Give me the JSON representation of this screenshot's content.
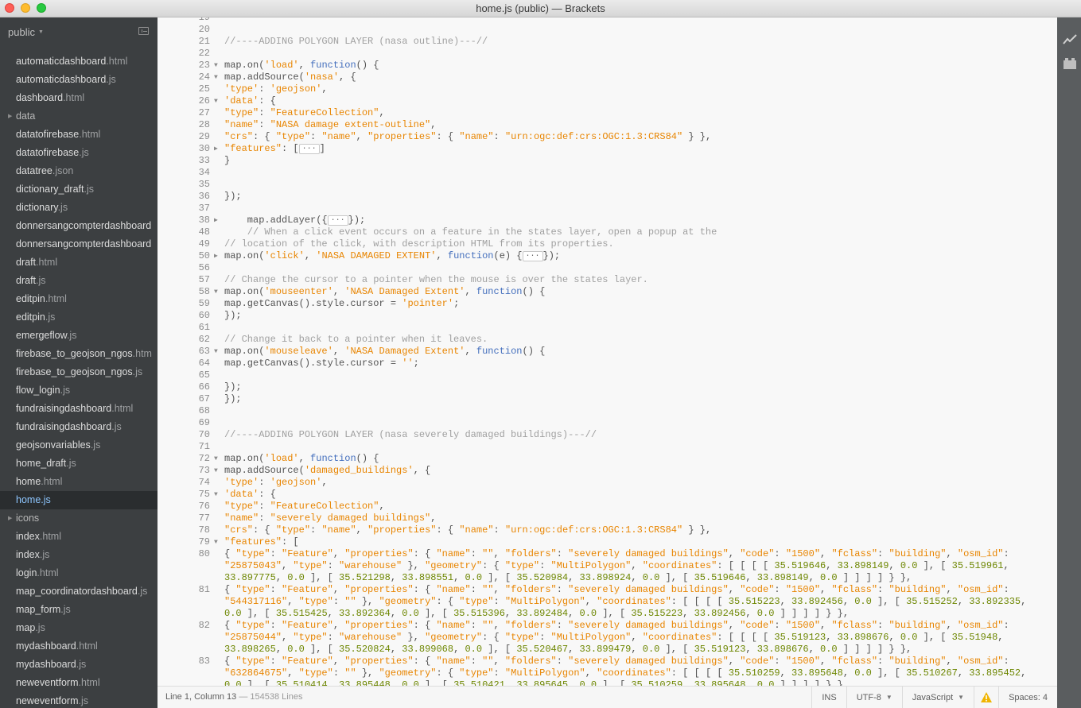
{
  "window": {
    "title": "home.js (public) — Brackets"
  },
  "sidebar": {
    "project_label": "public",
    "files": [
      {
        "name": "automaticdashboard",
        "ext": ".html",
        "type": "file"
      },
      {
        "name": "automaticdashboard",
        "ext": ".js",
        "type": "file"
      },
      {
        "name": "dashboard",
        "ext": ".html",
        "type": "file"
      },
      {
        "name": "data",
        "ext": "",
        "type": "folder"
      },
      {
        "name": "datatofirebase",
        "ext": ".html",
        "type": "file"
      },
      {
        "name": "datatofirebase",
        "ext": ".js",
        "type": "file"
      },
      {
        "name": "datatree",
        "ext": ".json",
        "type": "file"
      },
      {
        "name": "dictionary_draft",
        "ext": ".js",
        "type": "file"
      },
      {
        "name": "dictionary",
        "ext": ".js",
        "type": "file"
      },
      {
        "name": "donnersangcompterdashboard",
        "ext": "",
        "type": "file"
      },
      {
        "name": "donnersangcompterdashboard",
        "ext": "",
        "type": "file"
      },
      {
        "name": "draft",
        "ext": ".html",
        "type": "file"
      },
      {
        "name": "draft",
        "ext": ".js",
        "type": "file"
      },
      {
        "name": "editpin",
        "ext": ".html",
        "type": "file"
      },
      {
        "name": "editpin",
        "ext": ".js",
        "type": "file"
      },
      {
        "name": "emergeflow",
        "ext": ".js",
        "type": "file"
      },
      {
        "name": "firebase_to_geojson_ngos",
        "ext": ".htm",
        "type": "file"
      },
      {
        "name": "firebase_to_geojson_ngos",
        "ext": ".js",
        "type": "file"
      },
      {
        "name": "flow_login",
        "ext": ".js",
        "type": "file"
      },
      {
        "name": "fundraisingdashboard",
        "ext": ".html",
        "type": "file"
      },
      {
        "name": "fundraisingdashboard",
        "ext": ".js",
        "type": "file"
      },
      {
        "name": "geojsonvariables",
        "ext": ".js",
        "type": "file"
      },
      {
        "name": "home_draft",
        "ext": ".js",
        "type": "file"
      },
      {
        "name": "home",
        "ext": ".html",
        "type": "file"
      },
      {
        "name": "home",
        "ext": ".js",
        "type": "file",
        "selected": true
      },
      {
        "name": "icons",
        "ext": "",
        "type": "folder"
      },
      {
        "name": "index",
        "ext": ".html",
        "type": "file"
      },
      {
        "name": "index",
        "ext": ".js",
        "type": "file"
      },
      {
        "name": "login",
        "ext": ".html",
        "type": "file"
      },
      {
        "name": "map_coordinatordashboard",
        "ext": ".js",
        "type": "file"
      },
      {
        "name": "map_form",
        "ext": ".js",
        "type": "file"
      },
      {
        "name": "map",
        "ext": ".js",
        "type": "file"
      },
      {
        "name": "mydashboard",
        "ext": ".html",
        "type": "file"
      },
      {
        "name": "mydashboard",
        "ext": ".js",
        "type": "file"
      },
      {
        "name": "neweventform",
        "ext": ".html",
        "type": "file"
      },
      {
        "name": "neweventform",
        "ext": ".js",
        "type": "file"
      }
    ]
  },
  "editor": {
    "lines": [
      {
        "n": "19",
        "fold": "",
        "t": ""
      },
      {
        "n": "20",
        "fold": "",
        "t": ""
      },
      {
        "n": "21",
        "fold": "",
        "t": "//----ADDING POLYGON LAYER (nasa outline)---//"
      },
      {
        "n": "22",
        "fold": "",
        "t": ""
      },
      {
        "n": "23",
        "fold": "▼",
        "t": "map.on('load', function() {"
      },
      {
        "n": "24",
        "fold": "▼",
        "t": "map.addSource('nasa', {"
      },
      {
        "n": "25",
        "fold": "",
        "t": "'type': 'geojson',"
      },
      {
        "n": "26",
        "fold": "▼",
        "t": "'data': {"
      },
      {
        "n": "27",
        "fold": "",
        "t": "\"type\": \"FeatureCollection\","
      },
      {
        "n": "28",
        "fold": "",
        "t": "\"name\": \"NASA damage extent-outline\","
      },
      {
        "n": "29",
        "fold": "",
        "t": "\"crs\": { \"type\": \"name\", \"properties\": { \"name\": \"urn:ogc:def:crs:OGC:1.3:CRS84\" } },"
      },
      {
        "n": "30",
        "fold": "▶",
        "t": "\"features\": [···]"
      },
      {
        "n": "33",
        "fold": "",
        "t": "}"
      },
      {
        "n": "34",
        "fold": "",
        "t": ""
      },
      {
        "n": "35",
        "fold": "",
        "t": ""
      },
      {
        "n": "36",
        "fold": "",
        "t": "});"
      },
      {
        "n": "37",
        "fold": "",
        "t": ""
      },
      {
        "n": "38",
        "fold": "▶",
        "t": "    map.addLayer({···});"
      },
      {
        "n": "48",
        "fold": "",
        "t": "    // When a click event occurs on a feature in the states layer, open a popup at the"
      },
      {
        "n": "49",
        "fold": "",
        "t": "// location of the click, with description HTML from its properties."
      },
      {
        "n": "50",
        "fold": "▶",
        "t": "map.on('click', 'NASA DAMAGED EXTENT', function(e) {···});"
      },
      {
        "n": "56",
        "fold": "",
        "t": ""
      },
      {
        "n": "57",
        "fold": "",
        "t": "// Change the cursor to a pointer when the mouse is over the states layer."
      },
      {
        "n": "58",
        "fold": "▼",
        "t": "map.on('mouseenter', 'NASA Damaged Extent', function() {"
      },
      {
        "n": "59",
        "fold": "",
        "t": "map.getCanvas().style.cursor = 'pointer';"
      },
      {
        "n": "60",
        "fold": "",
        "t": "});"
      },
      {
        "n": "61",
        "fold": "",
        "t": ""
      },
      {
        "n": "62",
        "fold": "",
        "t": "// Change it back to a pointer when it leaves."
      },
      {
        "n": "63",
        "fold": "▼",
        "t": "map.on('mouseleave', 'NASA Damaged Extent', function() {"
      },
      {
        "n": "64",
        "fold": "",
        "t": "map.getCanvas().style.cursor = '';"
      },
      {
        "n": "65",
        "fold": "",
        "t": ""
      },
      {
        "n": "66",
        "fold": "",
        "t": "});"
      },
      {
        "n": "67",
        "fold": "",
        "t": "});"
      },
      {
        "n": "68",
        "fold": "",
        "t": ""
      },
      {
        "n": "69",
        "fold": "",
        "t": ""
      },
      {
        "n": "70",
        "fold": "",
        "t": "//----ADDING POLYGON LAYER (nasa severely damaged buildings)---//"
      },
      {
        "n": "71",
        "fold": "",
        "t": ""
      },
      {
        "n": "72",
        "fold": "▼",
        "t": "map.on('load', function() {"
      },
      {
        "n": "73",
        "fold": "▼",
        "t": "map.addSource('damaged_buildings', {"
      },
      {
        "n": "74",
        "fold": "",
        "t": "'type': 'geojson',"
      },
      {
        "n": "75",
        "fold": "▼",
        "t": "'data': {"
      },
      {
        "n": "76",
        "fold": "",
        "t": "\"type\": \"FeatureCollection\","
      },
      {
        "n": "77",
        "fold": "",
        "t": "\"name\": \"severely damaged buildings\","
      },
      {
        "n": "78",
        "fold": "",
        "t": "\"crs\": { \"type\": \"name\", \"properties\": { \"name\": \"urn:ogc:def:crs:OGC:1.3:CRS84\" } },"
      },
      {
        "n": "79",
        "fold": "▼",
        "t": "\"features\": ["
      },
      {
        "n": "80",
        "fold": "",
        "t": "{ \"type\": \"Feature\", \"properties\": { \"name\": \"\", \"folders\": \"severely damaged buildings\", \"code\": \"1500\", \"fclass\": \"building\", \"osm_id\":"
      },
      {
        "n": "",
        "fold": "",
        "t": "\"25875043\", \"type\": \"warehouse\" }, \"geometry\": { \"type\": \"MultiPolygon\", \"coordinates\": [ [ [ [ 35.519646, 33.898149, 0.0 ], [ 35.519961,"
      },
      {
        "n": "",
        "fold": "",
        "t": "33.897775, 0.0 ], [ 35.521298, 33.898551, 0.0 ], [ 35.520984, 33.898924, 0.0 ], [ 35.519646, 33.898149, 0.0 ] ] ] ] } },"
      },
      {
        "n": "81",
        "fold": "",
        "t": "{ \"type\": \"Feature\", \"properties\": { \"name\": \"\", \"folders\": \"severely damaged buildings\", \"code\": \"1500\", \"fclass\": \"building\", \"osm_id\":"
      },
      {
        "n": "",
        "fold": "",
        "t": "\"544317116\", \"type\": \"\" }, \"geometry\": { \"type\": \"MultiPolygon\", \"coordinates\": [ [ [ [ 35.515223, 33.892456, 0.0 ], [ 35.515252, 33.892335,"
      },
      {
        "n": "",
        "fold": "",
        "t": "0.0 ], [ 35.515425, 33.892364, 0.0 ], [ 35.515396, 33.892484, 0.0 ], [ 35.515223, 33.892456, 0.0 ] ] ] ] } },"
      },
      {
        "n": "82",
        "fold": "",
        "t": "{ \"type\": \"Feature\", \"properties\": { \"name\": \"\", \"folders\": \"severely damaged buildings\", \"code\": \"1500\", \"fclass\": \"building\", \"osm_id\":"
      },
      {
        "n": "",
        "fold": "",
        "t": "\"25875044\", \"type\": \"warehouse\" }, \"geometry\": { \"type\": \"MultiPolygon\", \"coordinates\": [ [ [ [ 35.519123, 33.898676, 0.0 ], [ 35.51948,"
      },
      {
        "n": "",
        "fold": "",
        "t": "33.898265, 0.0 ], [ 35.520824, 33.899068, 0.0 ], [ 35.520467, 33.899479, 0.0 ], [ 35.519123, 33.898676, 0.0 ] ] ] ] } },"
      },
      {
        "n": "83",
        "fold": "",
        "t": "{ \"type\": \"Feature\", \"properties\": { \"name\": \"\", \"folders\": \"severely damaged buildings\", \"code\": \"1500\", \"fclass\": \"building\", \"osm_id\":"
      },
      {
        "n": "",
        "fold": "",
        "t": "\"632864675\", \"type\": \"\" }, \"geometry\": { \"type\": \"MultiPolygon\", \"coordinates\": [ [ [ [ 35.510259, 33.895648, 0.0 ], [ 35.510267, 33.895452,"
      },
      {
        "n": "",
        "fold": "",
        "t": "0.0 ], [ 35.510414, 33.895448, 0.0 ], [ 35.510421, 33.895645, 0.0 ], [ 35.510259, 33.895648, 0.0 ] ] ] ] } },"
      }
    ]
  },
  "status": {
    "position": "Line 1, Column 13",
    "lines": "— 154538 Lines",
    "mode": "INS",
    "encoding": "UTF-8",
    "language": "JavaScript",
    "indent": "Spaces: 4"
  },
  "icons": {
    "live_preview": "live-preview-icon",
    "extension_manager": "extension-manager-icon",
    "warning": "warning-icon"
  },
  "colors": {
    "sidebar_bg": "#3c3f41",
    "selected_file": "#8ec6ff",
    "string": "#e88501",
    "keyword": "#446fbd",
    "comment": "#a0a0a0"
  }
}
